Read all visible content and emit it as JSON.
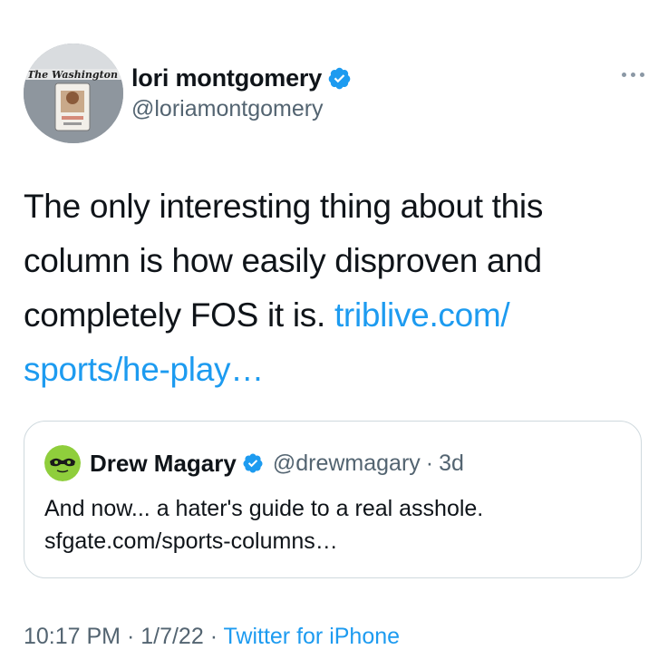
{
  "tweet": {
    "author": {
      "display_name": "lori montgomery",
      "handle": "@loriamontgomery",
      "verified": true,
      "avatar_icon": "avatar-photo"
    },
    "more_icon": "more-dots-icon",
    "text": "The only interesting thing about this column is how easily disproven and completely FOS it is.",
    "link_text": "triblive.com/​sports/he-play…",
    "quoted": {
      "display_name": "Drew Magary",
      "handle": "@drewmagary",
      "separator": "·",
      "time": "3d",
      "verified": true,
      "text": "And now... a hater's guide to a real asshole.",
      "link_text": "sfgate.com/sports-columns…"
    },
    "footer": {
      "time": "10:17 PM",
      "sep1": " · ",
      "date": "1/7/22",
      "sep2": " · ",
      "source": "Twitter for iPhone"
    }
  },
  "colors": {
    "text": "#0f1419",
    "secondary": "#536471",
    "link": "#1d9bf0",
    "verified": "#1d9bf0",
    "border": "#cfd9de"
  }
}
